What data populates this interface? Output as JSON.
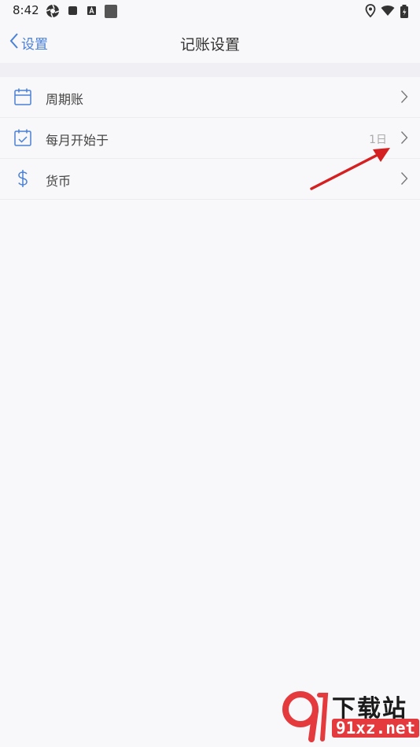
{
  "status_bar": {
    "time": "8:42",
    "left_icons": [
      "aperture-icon",
      "square-icon",
      "font-a-icon",
      "app-square-icon"
    ],
    "right_icons": [
      "location-icon",
      "wifi-icon",
      "battery-charging-icon"
    ]
  },
  "nav": {
    "back_label": "设置",
    "title": "记账设置"
  },
  "settings": {
    "items": [
      {
        "label": "周期账",
        "icon": "calendar-icon",
        "value": ""
      },
      {
        "label": "每月开始于",
        "icon": "calendar-check-icon",
        "value": "1日"
      },
      {
        "label": "货币",
        "icon": "dollar-icon",
        "value": ""
      }
    ]
  },
  "watermark": {
    "title": "下载站",
    "domain": "91xz.net"
  },
  "colors": {
    "accent": "#4a80d6",
    "background": "#f8f8fa",
    "annotation_arrow": "#d42020",
    "watermark_red": "#e43a3d"
  }
}
